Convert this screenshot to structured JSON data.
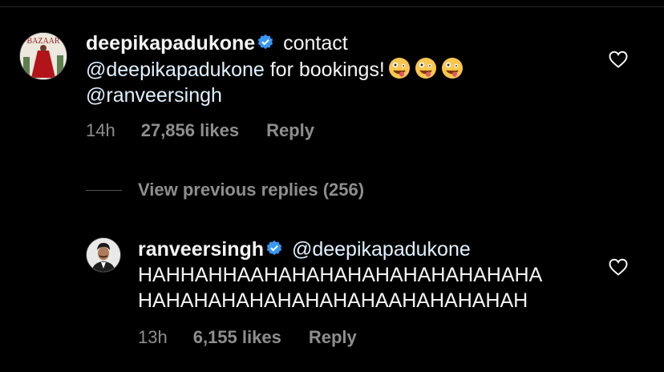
{
  "comment": {
    "username": "deepikapadukone",
    "text_before": "contact",
    "mention_1": "@deepikapadukone",
    "text_after": "for bookings!",
    "mention_2": "@ranveersingh",
    "time": "14h",
    "likes": "27,856 likes",
    "reply_label": "Reply",
    "avatar_text": "BAZAAR"
  },
  "view_replies": "View previous replies (256)",
  "reply": {
    "username": "ranveersingh",
    "mention": "@deepikapadukone",
    "line1": "HAHHAHHAAHAHAHAHAHAHAHAHAHAHA",
    "line2": "HAHAHAHAHAHAHAHAHAAHAHAHAHAH",
    "time": "13h",
    "likes": "6,155 likes",
    "reply_label": "Reply"
  },
  "colors": {
    "background": "#000000",
    "text": "#f5f5f5",
    "muted": "#8e8e8e",
    "verified": "#3897f0",
    "emoji": "#f9c74f"
  },
  "icons": [
    "verified-badge-icon",
    "zany-face-emoji",
    "heart-icon"
  ]
}
